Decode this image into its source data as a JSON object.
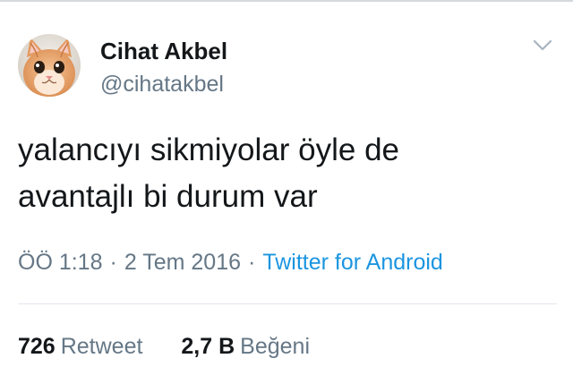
{
  "user": {
    "display_name": "Cihat Akbel",
    "handle": "@cihatakbel",
    "avatar_icon": "cat-avatar-icon"
  },
  "menu": {
    "icon": "chevron-down-icon",
    "color": "#a8b4bf"
  },
  "tweet": {
    "lines": [
      "yalancıyı sikmiyolar öyle de",
      "avantajlı bi durum var"
    ]
  },
  "meta": {
    "time": "ÖÖ 1:18",
    "separator": "·",
    "date": "2 Tem 2016",
    "source": "Twitter for Android"
  },
  "stats": {
    "retweets_count": "726",
    "retweets_label": "Retweet",
    "likes_count": "2,7 B",
    "likes_label": "Beğeni"
  },
  "colors": {
    "text": "#14171a",
    "secondary": "#657786",
    "link": "#1b95e0",
    "divider": "#e1e8ed"
  }
}
